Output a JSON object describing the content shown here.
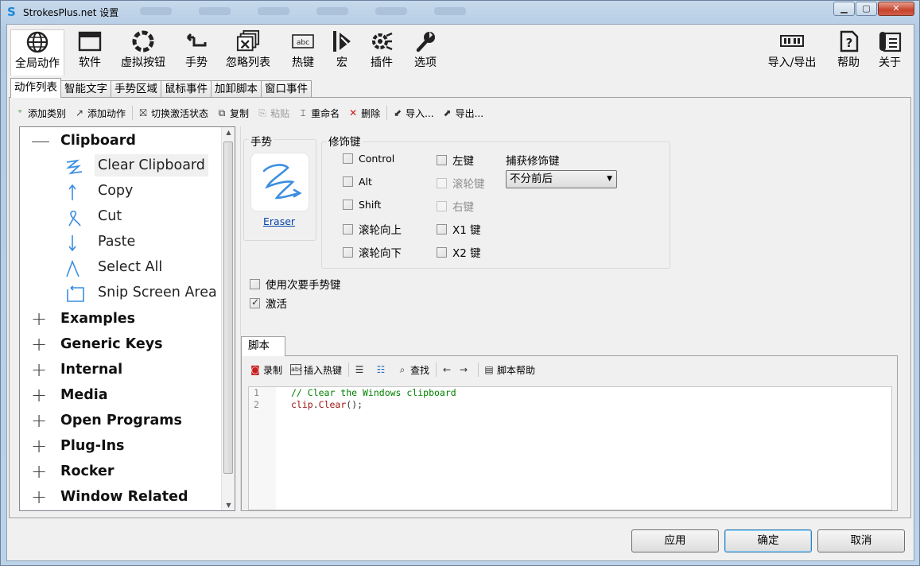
{
  "window": {
    "title": "StrokesPlus.net 设置",
    "controls": [
      "minimize",
      "maximize",
      "close"
    ]
  },
  "main_toolbar": [
    {
      "label": "全局动作",
      "icon": "globe-icon",
      "active": true
    },
    {
      "label": "软件",
      "icon": "window-icon"
    },
    {
      "label": "虚拟按钮",
      "icon": "ring-icon"
    },
    {
      "label": "手势",
      "icon": "gesture-icon"
    },
    {
      "label": "忽略列表",
      "icon": "ignore-list-icon"
    },
    {
      "label": "热键",
      "icon": "hotkey-icon"
    },
    {
      "label": "宏",
      "icon": "macro-icon"
    },
    {
      "label": "插件",
      "icon": "plugin-icon"
    },
    {
      "label": "选项",
      "icon": "wrench-icon"
    },
    {
      "label": "导入/导出",
      "icon": "import-export-icon"
    },
    {
      "label": "帮助",
      "icon": "help-icon"
    },
    {
      "label": "关于",
      "icon": "about-icon"
    }
  ],
  "tabs": [
    "动作列表",
    "智能文字",
    "手势区域",
    "鼠标事件",
    "加卸脚本",
    "窗口事件"
  ],
  "action_toolbar": [
    {
      "label": "添加类别",
      "icon": "add-category-icon"
    },
    {
      "label": "添加动作",
      "icon": "add-action-icon"
    },
    {
      "label": "切换激活状态",
      "icon": "toggle-active-icon"
    },
    {
      "label": "复制",
      "icon": "copy-icon"
    },
    {
      "label": "粘贴",
      "icon": "paste-icon",
      "disabled": true
    },
    {
      "label": "重命名",
      "icon": "rename-icon"
    },
    {
      "label": "删除",
      "icon": "delete-icon"
    },
    {
      "label": "导入...",
      "icon": "import-icon"
    },
    {
      "label": "导出...",
      "icon": "export-icon"
    }
  ],
  "tree": {
    "expanded_category": "Clipboard",
    "children": [
      "Clear Clipboard",
      "Copy",
      "Cut",
      "Paste",
      "Select All",
      "Snip Screen Area"
    ],
    "selected": "Clear Clipboard",
    "categories": [
      "Examples",
      "Generic Keys",
      "Internal",
      "Media",
      "Open Programs",
      "Plug-Ins",
      "Rocker",
      "Window Related"
    ]
  },
  "gesture": {
    "legend": "手势",
    "name": "Eraser"
  },
  "modifiers": {
    "legend": "修饰键",
    "col1": [
      {
        "label": "Control",
        "checked": false
      },
      {
        "label": "Alt",
        "checked": false
      },
      {
        "label": "Shift",
        "checked": false
      },
      {
        "label": "滚轮向上",
        "checked": false
      },
      {
        "label": "滚轮向下",
        "checked": false
      }
    ],
    "col2": [
      {
        "label": "左键",
        "checked": false,
        "disabled": false
      },
      {
        "label": "滚轮键",
        "checked": false,
        "disabled": true
      },
      {
        "label": "右键",
        "checked": false,
        "disabled": true
      },
      {
        "label": "X1 键",
        "checked": false,
        "disabled": false
      },
      {
        "label": "X2 键",
        "checked": false,
        "disabled": false
      }
    ],
    "capture_label": "捕获修饰键",
    "capture_value": "不分前后"
  },
  "options": [
    {
      "label": "使用次要手势键",
      "checked": false
    },
    {
      "label": "激活",
      "checked": true
    }
  ],
  "script": {
    "tab": "脚本",
    "toolbar": [
      {
        "label": "录制",
        "icon": "record-icon"
      },
      {
        "label": "插入热键",
        "icon": "insert-hotkey-icon"
      },
      {
        "label": "",
        "icon": "indent-icon"
      },
      {
        "label": "",
        "icon": "comment-icon"
      },
      {
        "label": "查找",
        "icon": "find-icon"
      },
      {
        "label": "",
        "icon": "back-arrow-icon"
      },
      {
        "label": "",
        "icon": "forward-arrow-icon"
      },
      {
        "label": "脚本帮助",
        "icon": "script-help-icon"
      }
    ],
    "line_numbers": [
      "1",
      "2"
    ],
    "line1": "// Clear the Windows clipboard",
    "line2_obj": "clip",
    "line2_dot": ".",
    "line2_method": "Clear",
    "line2_rest": "();"
  },
  "buttons": {
    "apply": "应用",
    "ok": "确定",
    "cancel": "取消"
  },
  "colors": {
    "accent": "#3c8ee0",
    "link": "#0645ad",
    "comment": "#008000",
    "identifier": "#a31515"
  }
}
